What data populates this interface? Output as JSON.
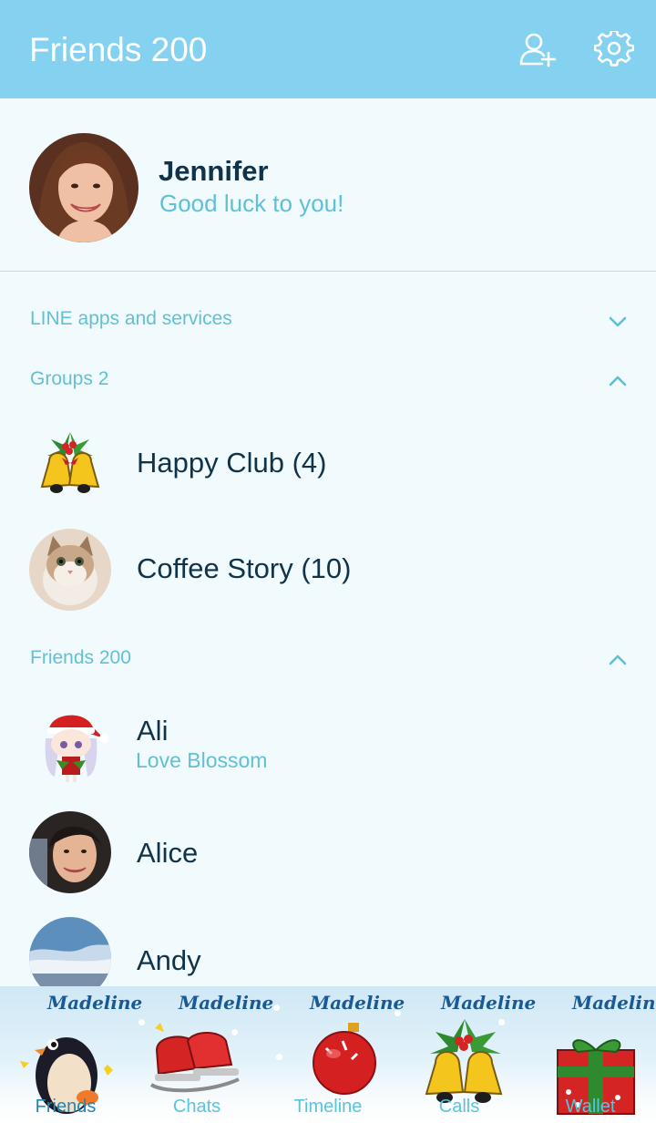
{
  "header": {
    "title": "Friends 200",
    "icons": [
      "add-friend-icon",
      "settings-icon"
    ]
  },
  "profile": {
    "name": "Jennifer",
    "status": "Good luck to you!"
  },
  "sections": {
    "line_apps": "LINE apps and services",
    "groups": "Groups 2",
    "friends": "Friends 200"
  },
  "groups": [
    {
      "name": "Happy Club (4)"
    },
    {
      "name": "Coffee Story (10)"
    }
  ],
  "friends": [
    {
      "name": "Ali",
      "status": "Love Blossom"
    },
    {
      "name": "Alice"
    },
    {
      "name": "Andy"
    }
  ],
  "tabs": [
    {
      "label": "Friends",
      "badge": "Madeline",
      "active": true
    },
    {
      "label": "Chats",
      "badge": "Madeline"
    },
    {
      "label": "Timeline",
      "badge": "Madeline"
    },
    {
      "label": "Calls",
      "badge": "Madeline"
    },
    {
      "label": "Wallet",
      "badge": "Madeline"
    }
  ],
  "colors": {
    "header": "#84d2ef",
    "background": "#f1fbfd",
    "accent": "#62bfd4",
    "name_text": "#11334a"
  }
}
